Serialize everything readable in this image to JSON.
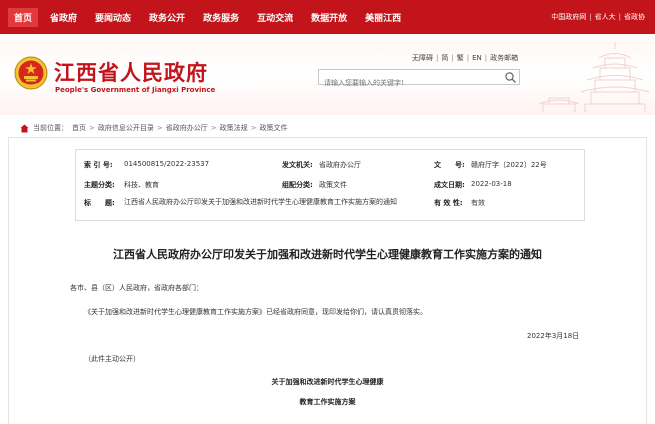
{
  "topnav": {
    "items": [
      "首页",
      "省政府",
      "要闻动态",
      "政务公开",
      "政务服务",
      "互动交流",
      "数据开放",
      "美丽江西"
    ],
    "right_links": [
      "中国政府网",
      "省人大",
      "省政协"
    ]
  },
  "header": {
    "title_cn": "江西省人民政府",
    "title_en": "People's Government of Jiangxi Province",
    "util_links": [
      "无障碍",
      "简",
      "繁",
      "EN",
      "政务邮箱"
    ],
    "search_placeholder": "请输入您要输入的关键字!"
  },
  "breadcrumb": {
    "label": "当前位置：",
    "items": [
      "首页",
      "政府信息公开目录",
      "省政府办公厅",
      "政策法规",
      "政策文件"
    ]
  },
  "meta": {
    "index_key": "索 引 号:",
    "index_val": "014500815/2022-23537",
    "issuer_key": "发文机关:",
    "issuer_val": "省政府办公厅",
    "docno_key": "文　　号:",
    "docno_val": "赣府厅字〔2022〕22号",
    "topic_key": "主题分类:",
    "topic_val": "科技、教育",
    "form_key": "组配分类:",
    "form_val": "政策文件",
    "date_key": "成文日期:",
    "date_val": "2022-03-18",
    "subject_key": "标　　题:",
    "subject_val": "江西省人民政府办公厅印发关于加强和改进新时代学生心理健康教育工作实施方案的通知",
    "valid_key": "有 效 性:",
    "valid_val": "有效"
  },
  "document": {
    "title": "江西省人民政府办公厅印发关于加强和改进新时代学生心理健康教育工作实施方案的通知",
    "salutation": "各市、县（区）人民政府，省政府各部门：",
    "body": "《关于加强和改进新时代学生心理健康教育工作实施方案》已经省政府同意，现印发给你们，请认真贯彻落实。",
    "date": "2022年3月18日",
    "note": "（此件主动公开）",
    "plan_title_1": "关于加强和改进新时代学生心理健康",
    "plan_title_2": "教育工作实施方案"
  },
  "colors": {
    "brand_red": "#c4141b",
    "nav_active": "#e03a3c"
  },
  "icons": [
    "national-emblem-icon",
    "search-icon",
    "home-icon",
    "tower-illustration"
  ]
}
